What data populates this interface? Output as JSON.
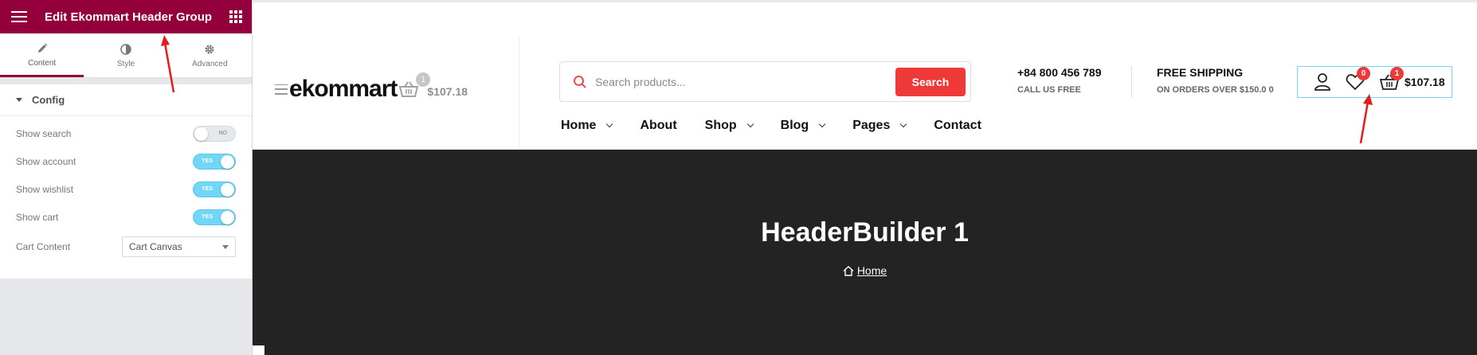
{
  "panel": {
    "title": "Edit Ekommart Header Group",
    "tabs": [
      {
        "label": "Content",
        "icon": "pencil-icon",
        "active": true
      },
      {
        "label": "Style",
        "icon": "contrast-icon",
        "active": false
      },
      {
        "label": "Advanced",
        "icon": "gear-icon",
        "active": false
      }
    ],
    "section": "Config",
    "controls": [
      {
        "label": "Show search",
        "state": "NO",
        "on": false
      },
      {
        "label": "Show account",
        "state": "YES",
        "on": true
      },
      {
        "label": "Show wishlist",
        "state": "YES",
        "on": true
      },
      {
        "label": "Show cart",
        "state": "YES",
        "on": true
      }
    ],
    "cart_content": {
      "label": "Cart Content",
      "value": "Cart Canvas"
    }
  },
  "site": {
    "logo": "ekommart",
    "logo_cart_count": "1",
    "logo_cart_amount": "$107.18",
    "search": {
      "placeholder": "Search products...",
      "button": "Search"
    },
    "contact": {
      "phone": "+84 800 456 789",
      "sub": "CALL US FREE"
    },
    "shipping": {
      "title": "FREE SHIPPING",
      "sub": "ON ORDERS OVER $150.0 0"
    },
    "wishlist_count": "0",
    "cart_count": "1",
    "cart_amount": "$107.18",
    "nav": [
      {
        "label": "Home",
        "dropdown": true
      },
      {
        "label": "About",
        "dropdown": false
      },
      {
        "label": "Shop",
        "dropdown": true
      },
      {
        "label": "Blog",
        "dropdown": true
      },
      {
        "label": "Pages",
        "dropdown": true
      },
      {
        "label": "Contact",
        "dropdown": false
      }
    ],
    "banner": {
      "title": "HeaderBuilder 1",
      "breadcrumb": "Home"
    }
  },
  "colors": {
    "panel_header": "#93003c",
    "toggle_on": "#71d7f7",
    "search_button": "#ef3939",
    "banner_bg": "#232323",
    "annotation_arrow": "#e11d1d"
  }
}
